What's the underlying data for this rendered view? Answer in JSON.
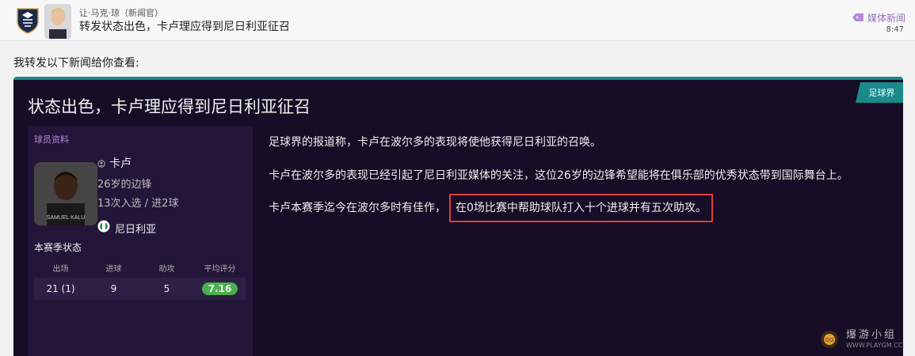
{
  "header": {
    "sender": "让·马克·琼（新闻官）",
    "subject": "转发状态出色，卡卢理应得到尼日利亚征召",
    "category": "媒体新闻",
    "time": "8:47"
  },
  "intro": "我转发以下新闻给你查看:",
  "article": {
    "source": "足球界",
    "headline": "状态出色，卡卢理应得到尼日利亚征召",
    "paragraphs": [
      "足球界的报道称，卡卢在波尔多的表现将使他获得尼日利亚的召唤。",
      "卡卢在波尔多的表现已经引起了尼日利亚媒体的关注，这位26岁的边锋希望能将在俱乐部的优秀状态带到国际舞台上。",
      "卡卢本赛季迄今在波尔多时有佳作，"
    ],
    "highlight": "在0场比赛中帮助球队打入十个进球并有五次助攻。"
  },
  "player": {
    "panel_title": "球员资料",
    "name": "卡卢",
    "age_position": "26岁的边锋",
    "caps": "13次入选 / 进2球",
    "nation": "尼日利亚",
    "shirt_text": "SAMUEL KALU",
    "season_title": "本赛季状态",
    "stats_headers": [
      "出场",
      "进球",
      "助攻",
      "平均评分"
    ],
    "stats": {
      "apps": "21 (1)",
      "goals": "9",
      "assists": "5",
      "rating": "7.16"
    }
  },
  "watermark": {
    "text": "爆游小组",
    "url": "WWW.PLAYGM.CC"
  },
  "colors": {
    "accent": "#1a8a8a",
    "card_bg": "#170d26",
    "panel_bg": "#231638",
    "highlight": "#e03c3c",
    "rating": "#4caf50",
    "category": "#9a6fc0"
  }
}
